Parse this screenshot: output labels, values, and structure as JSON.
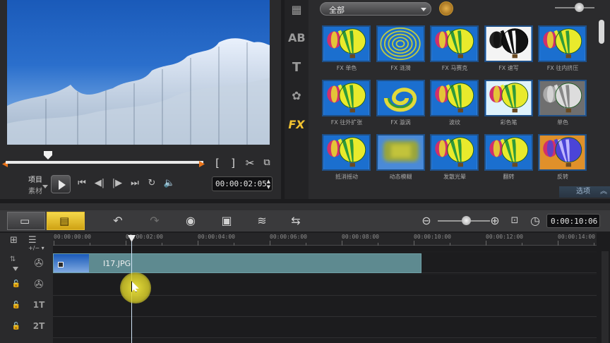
{
  "preview": {
    "mode_project": "项目",
    "mode_clip": "素材",
    "timecode": "00:00:02:05",
    "mark_in": "[",
    "mark_out": "]"
  },
  "library": {
    "category": "全部",
    "effects": [
      {
        "label": "FX 单色",
        "style": "balloon"
      },
      {
        "label": "FX 涟漪",
        "style": "ripple"
      },
      {
        "label": "FX 马赛克",
        "style": "balloon"
      },
      {
        "label": "FX 速写",
        "style": "sketch"
      },
      {
        "label": "FX 往内挤压",
        "style": "balloon"
      },
      {
        "label": "FX 往外扩张",
        "style": "balloon"
      },
      {
        "label": "FX 漩涡",
        "style": "swirl"
      },
      {
        "label": "波纹",
        "style": "balloon"
      },
      {
        "label": "彩色笔",
        "style": "pale"
      },
      {
        "label": "单色",
        "style": "mono"
      },
      {
        "label": "抵消摇动",
        "style": "balloon"
      },
      {
        "label": "动态模糊",
        "style": "blur"
      },
      {
        "label": "发散光晕",
        "style": "balloon"
      },
      {
        "label": "翻转",
        "style": "balloon"
      },
      {
        "label": "反转",
        "style": "invert"
      }
    ],
    "options_label": "选项"
  },
  "timeline": {
    "duration": "0:00:10:06",
    "ruler_ticks": [
      "00:00:00:00",
      "00:00:02:00",
      "00:00:04:00",
      "00:00:06:00",
      "00:00:08:00",
      "00:00:10:00",
      "00:00:12:00",
      "00:00:14:00"
    ],
    "clip_name": "I17.JPG",
    "track_add_label": "+/− ▾",
    "title_tracks": [
      "1T",
      "2T"
    ]
  }
}
